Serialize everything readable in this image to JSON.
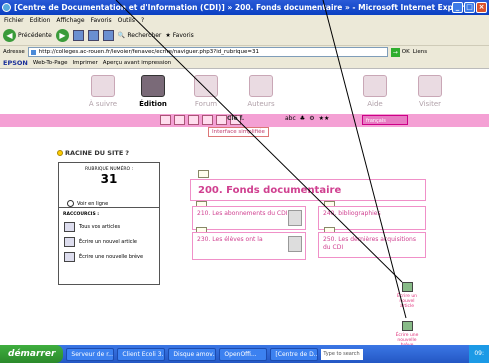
{
  "window": {
    "title": "[Centre de Documentation et d'Information (CDI)] » 200. Fonds documentaire » - Microsoft Internet Explorer"
  },
  "menu": [
    "Fichier",
    "Edition",
    "Affichage",
    "Favoris",
    "Outils",
    "?"
  ],
  "toolbar": {
    "back": "Précédente",
    "search": "Rechercher",
    "favorites": "Favoris"
  },
  "address": {
    "label": "Adresse",
    "url": "http://colleges.ac-rouen.fr/levoier/fenavec/ecrire/naviguer.php3?id_rubrique=31",
    "go": "OK",
    "links": "Liens"
  },
  "epson": {
    "brand": "EPSON",
    "webtopage": "Web-To-Page",
    "print": "Imprimer",
    "preview": "Aperçu avant impression"
  },
  "nav": [
    {
      "label": "À suivre"
    },
    {
      "label": "Édition"
    },
    {
      "label": "Forum"
    },
    {
      "label": "Auteurs"
    },
    {
      "label": "Aide"
    },
    {
      "label": "Visiter"
    }
  ],
  "pinkbar": {
    "clef": "Clé f.",
    "lang": "français",
    "tooltip": "Interface simplifiée"
  },
  "racine": "RACINE DU SITE",
  "rubrique": {
    "label": "RUBRIQUE NUMÉRO :",
    "number": "31",
    "voir": "Voir en ligne"
  },
  "raccourcis": {
    "title": "RACCOURCIS :",
    "items": [
      "Tous vos articles",
      "Écrire un nouvel article",
      "Écrire une nouvelle brève"
    ]
  },
  "main": {
    "title": "200. Fonds documentaire"
  },
  "subs": [
    "210. Les abonnements du CDI",
    "240. bibliographies",
    "230. Les élèves ont la",
    "250. Les dernières acquisitions du CDI"
  ],
  "side": {
    "article": "Écrire un nouvel article",
    "breve": "Écrire une nouvelle brève"
  },
  "taskbar": {
    "start": "démarrer",
    "tasks": [
      "Serveur de r...",
      "Client Ecoli 3...",
      "Disque amov...",
      "OpenOffi...",
      "[Centre de D..."
    ],
    "search": "Type to search",
    "time": "09:"
  }
}
